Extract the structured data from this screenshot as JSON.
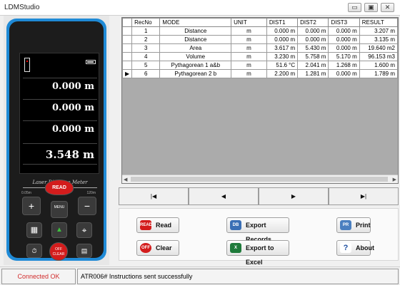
{
  "window": {
    "title": "LDMStudio",
    "min_glyph": "▭",
    "max_glyph": "▣",
    "close_glyph": "✕"
  },
  "device": {
    "readings": [
      "0.000 m",
      "0.000 m",
      "0.000 m"
    ],
    "main_reading": "3.548 m",
    "label": "Laser Distance Meter",
    "scale_min": "0.05m",
    "scale_max": "120m",
    "keys": {
      "read": "READ",
      "plus": "+",
      "minus": "−",
      "menu": "MENU",
      "off": "OFF CLEAR",
      "grid": "▦",
      "green": "▲",
      "target": "⌖",
      "timer": "⏱",
      "save": "▤"
    }
  },
  "table": {
    "columns": [
      "RecNo",
      "MODE",
      "UNIT",
      "DIST1",
      "DIST2",
      "DIST3",
      "RESULT"
    ],
    "rows": [
      {
        "recno": "1",
        "mode": "Distance",
        "unit": "m",
        "d1": "0.000 m",
        "d2": "0.000 m",
        "d3": "0.000 m",
        "result": "3.207 m",
        "current": false
      },
      {
        "recno": "2",
        "mode": "Distance",
        "unit": "m",
        "d1": "0.000 m",
        "d2": "0.000 m",
        "d3": "0.000 m",
        "result": "3.135 m",
        "current": false
      },
      {
        "recno": "3",
        "mode": "Area",
        "unit": "m",
        "d1": "3.617 m",
        "d2": "5.430 m",
        "d3": "0.000 m",
        "result": "19.640 m2",
        "current": false
      },
      {
        "recno": "4",
        "mode": "Volume",
        "unit": "m",
        "d1": "3.230 m",
        "d2": "5.758 m",
        "d3": "5.170 m",
        "result": "96.153 m3",
        "current": false
      },
      {
        "recno": "5",
        "mode": "Pythagorean 1 a&b",
        "unit": "m",
        "d1": "51.6 °C",
        "d2": "2.041 m",
        "d3": "1.268 m",
        "result": "1.600 m",
        "current": false
      },
      {
        "recno": "6",
        "mode": "Pythagorean 2 b",
        "unit": "m",
        "d1": "2.200 m",
        "d2": "1.281 m",
        "d3": "0.000 m",
        "result": "1.789 m",
        "current": true
      }
    ],
    "current_marker": "▶",
    "scroll_left": "◀",
    "scroll_right": "▶"
  },
  "nav": {
    "first": "|◀",
    "prev": "◀",
    "next": "▶",
    "last": "▶|"
  },
  "actions": {
    "read": {
      "label": "Read",
      "icon": "read-icon",
      "icon_text": "READ"
    },
    "clear": {
      "label": "Clear",
      "icon": "clear-icon",
      "icon_text": "OFF"
    },
    "export_records": {
      "label": "Export Records",
      "icon": "database-export-icon",
      "icon_text": "DB"
    },
    "export_excel": {
      "label": "Export to Excel",
      "icon": "excel-icon",
      "icon_text": "X"
    },
    "print": {
      "label": "Print",
      "icon": "printer-icon",
      "icon_text": "PR"
    },
    "about": {
      "label": "About",
      "icon": "help-icon",
      "icon_text": "?"
    }
  },
  "status": {
    "connection": "Connected OK",
    "message": "ATR006#  Instructions sent successfully"
  },
  "colors": {
    "device_blue": "#1f8ad6",
    "device_red": "#d31c1c",
    "status_red": "#d12b2b",
    "excel_green": "#1e7a3a"
  }
}
